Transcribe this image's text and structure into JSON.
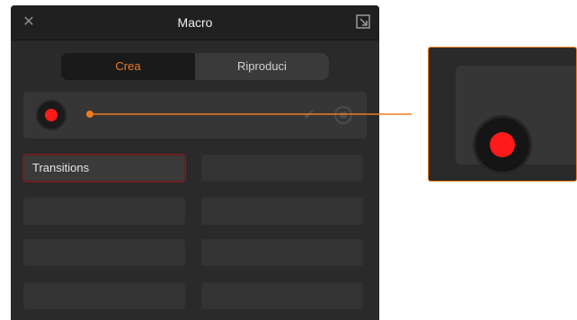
{
  "panel": {
    "title": "Macro",
    "close_icon": "close-icon",
    "popout_icon": "popout-icon"
  },
  "tabs": [
    {
      "label": "Crea",
      "active": true
    },
    {
      "label": "Riproduci",
      "active": false
    }
  ],
  "record_row": {
    "record_icon": "record-icon",
    "check_icon": "check-icon",
    "stop_icon": "stop-icon"
  },
  "macros": [
    {
      "label": "Transitions",
      "selected": true
    },
    {
      "label": ""
    },
    {
      "label": ""
    },
    {
      "label": ""
    },
    {
      "label": ""
    },
    {
      "label": ""
    },
    {
      "label": ""
    },
    {
      "label": ""
    }
  ],
  "colors": {
    "accent": "#f07a1e",
    "record": "#ff1a1a",
    "panel_bg": "#2a2a2a",
    "selected_border": "#7a2222"
  }
}
